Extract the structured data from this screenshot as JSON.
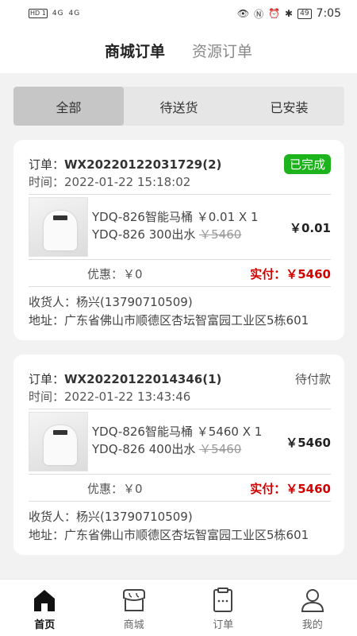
{
  "status_bar": {
    "left_badge": "HD 1",
    "signal1": "4G",
    "signal2": "4G",
    "battery": "49",
    "time": "7:05"
  },
  "top_tabs": [
    {
      "label": "商城订单",
      "active": true
    },
    {
      "label": "资源订单",
      "active": false
    }
  ],
  "filter_tabs": [
    {
      "label": "全部",
      "active": true
    },
    {
      "label": "待送货",
      "active": false
    },
    {
      "label": "已安装",
      "active": false
    }
  ],
  "orders": [
    {
      "id_label": "订单：",
      "id": "WX20220122031729(2)",
      "status": "已完成",
      "time_label": "时间：",
      "time": "2022-01-22 15:18:02",
      "line1": "YDQ-826智能马桶 ￥0.01 X 1",
      "line2_prefix": "YDQ-826 300出水 ",
      "line2_strike": "￥5460",
      "price": "￥0.01",
      "discount_label": "优惠：",
      "discount": "￥0",
      "paid_label": "实付：",
      "paid": "￥5460",
      "receiver_label": "收货人：",
      "receiver": "杨兴(13790710509)",
      "address_label": "地址：",
      "address": "广东省佛山市顺德区杏坛智富园工业区5栋601"
    },
    {
      "id_label": "订单：",
      "id": "WX20220122014346(1)",
      "status": "待付款",
      "time_label": "时间：",
      "time": "2022-01-22 13:43:46",
      "line1": "YDQ-826智能马桶 ￥5460 X 1",
      "line2_prefix": "YDQ-826 400出水 ",
      "line2_strike": "￥5460",
      "price": "￥5460",
      "discount_label": "优惠：",
      "discount": "￥0",
      "paid_label": "实付：",
      "paid": "￥5460",
      "receiver_label": "收货人：",
      "receiver": "杨兴(13790710509)",
      "address_label": "地址：",
      "address": "广东省佛山市顺德区杏坛智富园工业区5栋601"
    }
  ],
  "bottom_nav": [
    {
      "label": "首页",
      "icon": "home-icon",
      "active": true
    },
    {
      "label": "商城",
      "icon": "store-icon",
      "active": false
    },
    {
      "label": "订单",
      "icon": "order-icon",
      "active": false
    },
    {
      "label": "我的",
      "icon": "profile-icon",
      "active": false
    }
  ],
  "colors": {
    "paid": "#d40000",
    "done_badge": "#1db31d"
  }
}
